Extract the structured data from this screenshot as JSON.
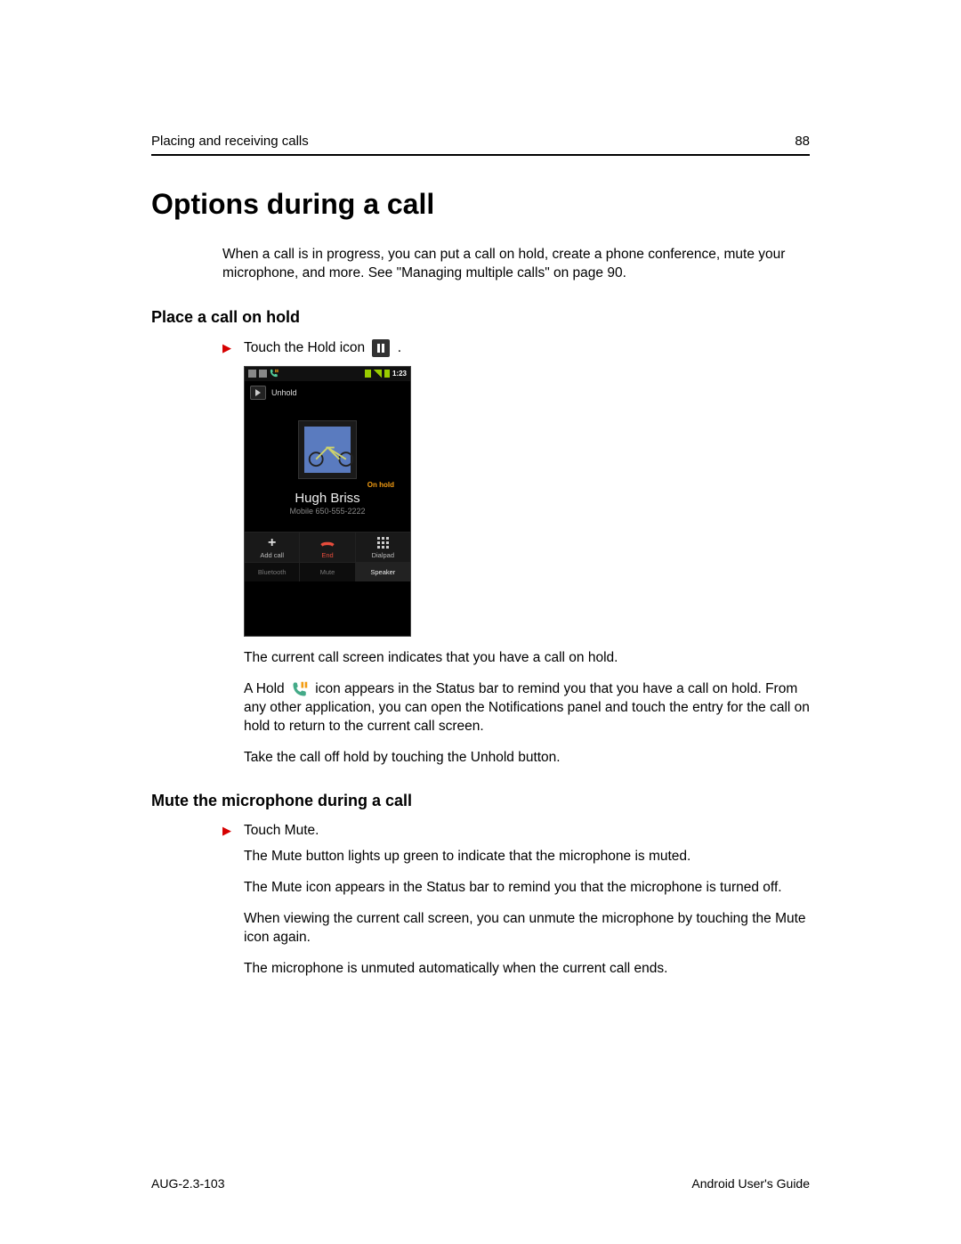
{
  "header": {
    "section": "Placing and receiving calls",
    "page": "88"
  },
  "title": "Options during a call",
  "intro": "When a call is in progress, you can put a call on hold, create a phone conference, mute your microphone, and more. See \"Managing multiple calls\" on page 90.",
  "section1": {
    "heading": "Place a call on hold",
    "step_before": "Touch the Hold icon",
    "step_after": ".",
    "p1": "The current call screen indicates that you have a call on hold.",
    "p2a": "A Hold ",
    "p2b": " icon appears in the Status bar to remind you that you have a call on hold. From any other application, you can open the Notifications panel and touch the entry for the call on hold to return to the current call screen.",
    "p3": "Take the call off hold by touching the Unhold button."
  },
  "section2": {
    "heading": "Mute the microphone during a call",
    "step": "Touch Mute.",
    "p1": "The Mute button lights up green to indicate that the microphone is muted.",
    "p2": "The Mute icon appears in the Status bar to remind you that the microphone is turned off.",
    "p3": "When viewing the current call screen, you can unmute the microphone by touching the Mute icon again.",
    "p4": "The microphone is unmuted automatically when the current call ends."
  },
  "phone": {
    "time": "1:23",
    "unhold": "Unhold",
    "onhold": "On hold",
    "name": "Hugh Briss",
    "number": "Mobile 650-555-2222",
    "addcall": "Add call",
    "end": "End",
    "dialpad": "Dialpad",
    "bluetooth": "Bluetooth",
    "mute": "Mute",
    "speaker": "Speaker"
  },
  "footer": {
    "left": "AUG-2.3-103",
    "right": "Android User's Guide"
  }
}
